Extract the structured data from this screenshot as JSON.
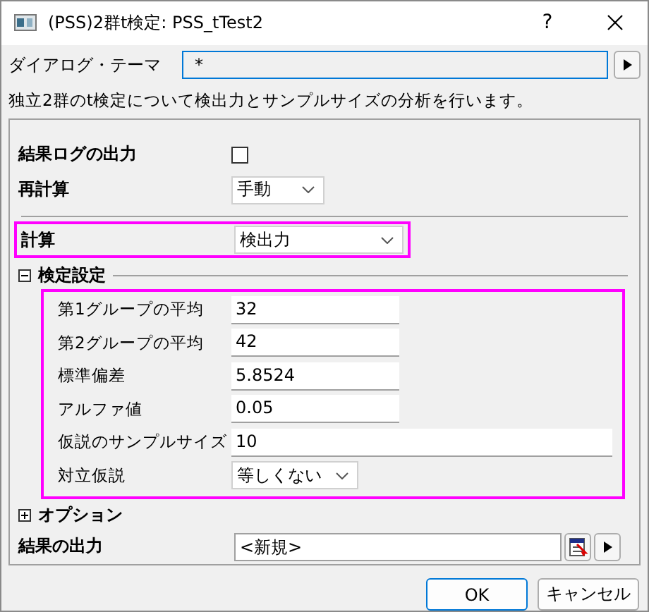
{
  "window": {
    "title": "(PSS)2群t検定: PSS_tTest2",
    "help": "?"
  },
  "theme": {
    "label": "ダイアログ・テーマ",
    "value": "*"
  },
  "description": "独立2群のt検定について検出力とサンプルサイズの分析を行います。",
  "top_rows": [
    {
      "kind": "checkbox",
      "label": "結果ログの出力",
      "checked": false
    },
    {
      "kind": "dropdown",
      "label": "再計算",
      "value": "手動"
    }
  ],
  "calc_row": {
    "label": "計算",
    "value": "検出力",
    "highlighted": true
  },
  "test_settings": {
    "label": "検定設定",
    "expanded": true,
    "highlighted": true,
    "rows": [
      {
        "kind": "input",
        "label": "第1グループの平均",
        "value": "32"
      },
      {
        "kind": "input",
        "label": "第2グループの平均",
        "value": "42"
      },
      {
        "kind": "input",
        "label": "標準偏差",
        "value": "5.8524"
      },
      {
        "kind": "input",
        "label": "アルファ値",
        "value": "0.05"
      },
      {
        "kind": "long-input",
        "label": "仮説のサンプルサイズ",
        "value": "10"
      },
      {
        "kind": "dropdown",
        "label": "対立仮説",
        "value": "等しくない"
      }
    ]
  },
  "options": {
    "label": "オプション",
    "expanded": false
  },
  "output": {
    "label": "結果の出力",
    "value": "<新規>"
  },
  "buttons": [
    {
      "label": "OK",
      "default": true
    },
    {
      "label": "キャンセル",
      "default": false
    }
  ]
}
